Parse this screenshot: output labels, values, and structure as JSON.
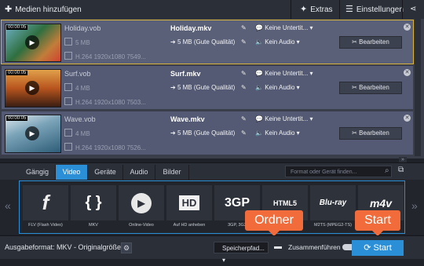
{
  "toolbar": {
    "add_media": "Medien hinzufügen",
    "extras": "Extras",
    "settings": "Einstellungen"
  },
  "files": [
    {
      "duration": "00:00:05",
      "source_name": "Holiday.vob",
      "source_size": "5 MB",
      "source_codec": "H.264 1920x1080 7549...",
      "output_name": "Holiday.mkv",
      "output_size": "5 MB (Gute Qualität)",
      "subtitle": "Keine Untertit...",
      "audio": "Kein Audio",
      "edit": "Bearbeiten"
    },
    {
      "duration": "00:00:05",
      "source_name": "Surf.vob",
      "source_size": "4 MB",
      "source_codec": "H.264 1920x1080 7503...",
      "output_name": "Surf.mkv",
      "output_size": "5 MB (Gute Qualität)",
      "subtitle": "Keine Untertit...",
      "audio": "Kein Audio",
      "edit": "Bearbeiten"
    },
    {
      "duration": "00:00:05",
      "source_name": "Wave.vob",
      "source_size": "4 MB",
      "source_codec": "H.264 1920x1080 7526...",
      "output_name": "Wave.mkv",
      "output_size": "5 MB (Gute Qualität)",
      "subtitle": "Keine Untertit...",
      "audio": "Kein Audio",
      "edit": "Bearbeiten"
    }
  ],
  "tabs": [
    "Gängig",
    "Video",
    "Geräte",
    "Audio",
    "Bilder"
  ],
  "active_tab": "Video",
  "search": {
    "placeholder": "Format oder Gerät finden..."
  },
  "formats": [
    {
      "glyph": "f",
      "label": "FLV (Flash Video)"
    },
    {
      "glyph": "{ }",
      "label": "MKV"
    },
    {
      "glyph": "▶",
      "label": "Online-Video"
    },
    {
      "glyph": "HD",
      "label": "Auf HD anheben"
    },
    {
      "glyph": "3GP",
      "label": "3GP, 3G2"
    },
    {
      "glyph": "HTML5",
      "label": ""
    },
    {
      "glyph": "Blu-ray",
      "label": "M2TS (MPEG2-TS)"
    },
    {
      "glyph": "m4v",
      "label": ""
    }
  ],
  "bottom": {
    "output_format": "Ausgabeformat: MKV - Originalgröße",
    "save_path": "Speicherpfad...",
    "merge": "Zusammenführen",
    "start": "Start"
  },
  "callouts": {
    "folder": "Ordner",
    "start": "Start"
  },
  "colors": {
    "accent": "#2b8fd8",
    "callout": "#f26b3a",
    "selected_border": "#d8b23a"
  }
}
